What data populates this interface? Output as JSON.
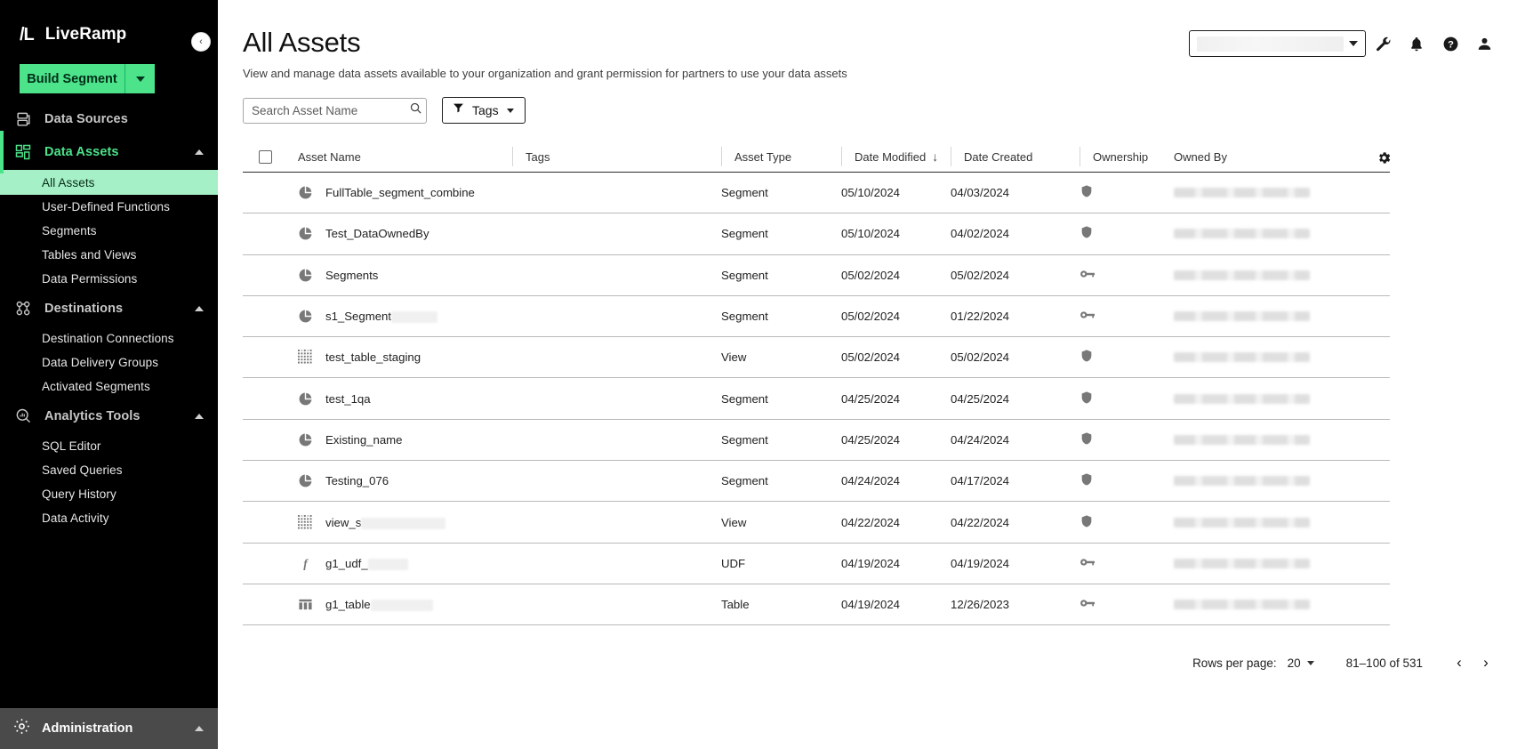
{
  "brand": {
    "logo": "/L",
    "name": "LiveRamp"
  },
  "sidebar": {
    "build_button": {
      "label": "Build Segment",
      "caret_icon": "chevron-down-icon"
    },
    "collapse_icon": "‹",
    "groups": [
      {
        "label": "Data Sources",
        "icon": "data-sources-icon",
        "active": false,
        "expanded": false,
        "items": []
      },
      {
        "label": "Data Assets",
        "icon": "data-assets-icon",
        "active": true,
        "expanded": true,
        "items": [
          {
            "label": "All Assets",
            "selected": true
          },
          {
            "label": "User-Defined Functions",
            "selected": false
          },
          {
            "label": "Segments",
            "selected": false
          },
          {
            "label": "Tables and Views",
            "selected": false
          },
          {
            "label": "Data Permissions",
            "selected": false
          }
        ]
      },
      {
        "label": "Destinations",
        "icon": "destinations-icon",
        "active": false,
        "expanded": true,
        "items": [
          {
            "label": "Destination Connections",
            "selected": false
          },
          {
            "label": "Data Delivery Groups",
            "selected": false
          },
          {
            "label": "Activated Segments",
            "selected": false
          }
        ]
      },
      {
        "label": "Analytics Tools",
        "icon": "analytics-tools-icon",
        "active": false,
        "expanded": true,
        "items": [
          {
            "label": "SQL Editor",
            "selected": false
          },
          {
            "label": "Saved Queries",
            "selected": false
          },
          {
            "label": "Query History",
            "selected": false
          },
          {
            "label": "Data Activity",
            "selected": false
          }
        ]
      }
    ],
    "administration": {
      "label": "Administration",
      "icon": "gear-icon"
    }
  },
  "topbar": {
    "org_selector": {
      "value": "",
      "caret_icon": "chevron-down-icon"
    },
    "icons": [
      {
        "name": "wrench-icon"
      },
      {
        "name": "bell-icon"
      },
      {
        "name": "help-icon"
      },
      {
        "name": "user-icon"
      }
    ]
  },
  "page": {
    "title": "All Assets",
    "subtitle": "View and manage data assets available to your organization and grant permission for partners to use your data assets"
  },
  "filters": {
    "search_placeholder": "Search Asset Name",
    "search_value": "",
    "search_icon": "search-icon",
    "tags_button": {
      "label": "Tags",
      "icon": "filter-icon",
      "caret_icon": "chevron-down-icon"
    }
  },
  "table": {
    "settings_icon": "gear-icon",
    "sort_column": "Date Modified",
    "sort_direction_icon": "↓",
    "columns": [
      {
        "key": "name",
        "label": "Asset Name"
      },
      {
        "key": "tags",
        "label": "Tags"
      },
      {
        "key": "type",
        "label": "Asset Type"
      },
      {
        "key": "modified",
        "label": "Date Modified"
      },
      {
        "key": "created",
        "label": "Date Created"
      },
      {
        "key": "ownership",
        "label": "Ownership"
      },
      {
        "key": "owned_by",
        "label": "Owned By"
      }
    ],
    "rows": [
      {
        "name": "FullTable_segment_combine",
        "name_redacted": 0,
        "icon": "segment-icon",
        "tags": "",
        "type": "Segment",
        "modified": "05/10/2024",
        "created": "04/03/2024",
        "ownership": "shield-icon",
        "owned_by": ""
      },
      {
        "name": "Test_DataOwnedBy",
        "name_redacted": 0,
        "icon": "segment-icon",
        "tags": "",
        "type": "Segment",
        "modified": "05/10/2024",
        "created": "04/02/2024",
        "ownership": "shield-icon",
        "owned_by": ""
      },
      {
        "name": "Segments",
        "name_redacted": 0,
        "icon": "segment-icon",
        "tags": "",
        "type": "Segment",
        "modified": "05/02/2024",
        "created": "05/02/2024",
        "ownership": "key-icon",
        "owned_by": ""
      },
      {
        "name": "s1_Segment",
        "name_redacted": 52,
        "icon": "segment-icon",
        "tags": "",
        "type": "Segment",
        "modified": "05/02/2024",
        "created": "01/22/2024",
        "ownership": "key-icon",
        "owned_by": ""
      },
      {
        "name": "test_table_staging",
        "name_redacted": 0,
        "icon": "view-icon",
        "tags": "",
        "type": "View",
        "modified": "05/02/2024",
        "created": "05/02/2024",
        "ownership": "shield-icon",
        "owned_by": ""
      },
      {
        "name": "test_1qa",
        "name_redacted": 0,
        "icon": "segment-icon",
        "tags": "",
        "type": "Segment",
        "modified": "04/25/2024",
        "created": "04/25/2024",
        "ownership": "shield-icon",
        "owned_by": ""
      },
      {
        "name": "Existing_name",
        "name_redacted": 0,
        "icon": "segment-icon",
        "tags": "",
        "type": "Segment",
        "modified": "04/25/2024",
        "created": "04/24/2024",
        "ownership": "shield-icon",
        "owned_by": ""
      },
      {
        "name": "Testing_076",
        "name_redacted": 0,
        "icon": "segment-icon",
        "tags": "",
        "type": "Segment",
        "modified": "04/24/2024",
        "created": "04/17/2024",
        "ownership": "shield-icon",
        "owned_by": ""
      },
      {
        "name": "view_s",
        "name_redacted": 95,
        "icon": "view-icon",
        "tags": "",
        "type": "View",
        "modified": "04/22/2024",
        "created": "04/22/2024",
        "ownership": "shield-icon",
        "owned_by": ""
      },
      {
        "name": "g1_udf_",
        "name_redacted": 45,
        "icon": "udf-icon",
        "tags": "",
        "type": "UDF",
        "modified": "04/19/2024",
        "created": "04/19/2024",
        "ownership": "key-icon",
        "owned_by": ""
      },
      {
        "name": "g1_table",
        "name_redacted": 70,
        "icon": "table-icon",
        "tags": "",
        "type": "Table",
        "modified": "04/19/2024",
        "created": "12/26/2023",
        "ownership": "key-icon",
        "owned_by": ""
      }
    ]
  },
  "pagination": {
    "rows_per_page_label": "Rows per page:",
    "rows_per_page_value": "20",
    "range": "81–100 of 531",
    "prev_icon": "‹",
    "next_icon": "›"
  },
  "colors": {
    "accent_green": "#4ce38a",
    "selected_green": "#a5f0c6",
    "sidebar_bg": "#000000",
    "admin_bg": "#4a4a4a"
  }
}
